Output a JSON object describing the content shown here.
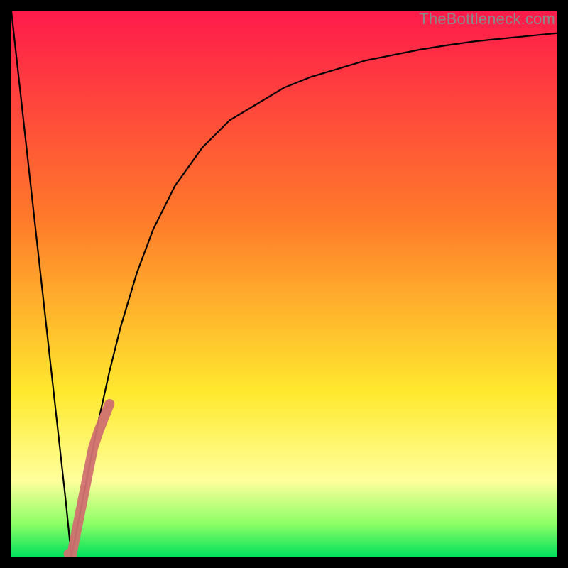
{
  "watermark": "TheBottleneck.com",
  "chart_data": {
    "type": "line",
    "title": "",
    "xlabel": "",
    "ylabel": "",
    "xlim": [
      0,
      100
    ],
    "ylim": [
      0,
      100
    ],
    "grid": false,
    "legend": null,
    "series": [
      {
        "name": "black-curve",
        "color": "#000000",
        "x": [
          0,
          5,
          10,
          11,
          12,
          14,
          16,
          18,
          20,
          23,
          26,
          30,
          35,
          40,
          45,
          50,
          55,
          60,
          65,
          70,
          75,
          80,
          85,
          90,
          95,
          100
        ],
        "y": [
          100,
          55,
          10,
          0,
          5,
          15,
          25,
          34,
          42,
          52,
          60,
          68,
          75,
          80,
          83,
          86,
          88,
          89.5,
          91,
          92,
          93,
          93.8,
          94.5,
          95,
          95.5,
          96
        ]
      },
      {
        "name": "pink-overlay",
        "color": "#d07070",
        "x": [
          10.5,
          11,
          12,
          13,
          14,
          15,
          16,
          17,
          18
        ],
        "y": [
          0.5,
          0,
          5,
          10,
          15,
          20,
          23,
          25.5,
          28
        ]
      }
    ],
    "background_gradient": {
      "top": "#ff1b4b",
      "orange": "#ff7a2a",
      "yellow": "#ffe92e",
      "pale": "#ffff9c",
      "green1": "#8dff66",
      "green2": "#00e05c"
    }
  }
}
